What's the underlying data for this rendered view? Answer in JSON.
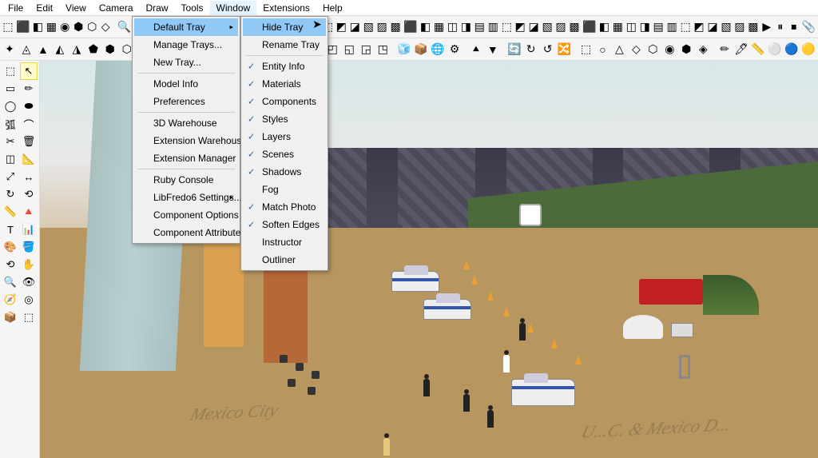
{
  "menubar": [
    "File",
    "Edit",
    "View",
    "Camera",
    "Draw",
    "Tools",
    "Window",
    "Extensions",
    "Help"
  ],
  "active_menu": "Window",
  "window_menu": {
    "groups": [
      [
        "Default Tray",
        "Manage Trays...",
        "New Tray..."
      ],
      [
        "Model Info",
        "Preferences"
      ],
      [
        "3D Warehouse",
        "Extension Warehouse",
        "Extension Manager"
      ],
      [
        "Ruby Console",
        "LibFredo6 Settings...",
        "Component Options",
        "Component Attributes"
      ]
    ],
    "highlighted": "Default Tray",
    "has_submenu": [
      "Default Tray",
      "LibFredo6 Settings..."
    ]
  },
  "tray_submenu": {
    "groups": [
      [
        "Hide Tray",
        "Rename Tray"
      ],
      [
        "Entity Info",
        "Materials",
        "Components",
        "Styles",
        "Layers",
        "Scenes",
        "Shadows",
        "Fog",
        "Match Photo",
        "Soften Edges",
        "Instructor",
        "Outliner"
      ]
    ],
    "highlighted": "Hide Tray",
    "checked": [
      "Entity Info",
      "Materials",
      "Components",
      "Styles",
      "Layers",
      "Scenes",
      "Shadows",
      "Match Photo",
      "Soften Edges"
    ]
  },
  "toolbar1_icons": [
    "⬚",
    "⬛",
    "◧",
    "▦",
    "◉",
    "⬢",
    "⬡",
    "◇",
    "",
    "🔍",
    "✋",
    "◎",
    ",⟲",
    "🏠",
    "",
    "📁",
    "🔧",
    "🗂",
    "📐",
    "",
    "◫",
    "◨",
    "▤",
    "▥",
    "⬚",
    "◩",
    "◪",
    "▧",
    "▨",
    "▩",
    "⬛",
    "◧",
    "▦",
    "◫",
    "◨",
    "▤",
    "▥",
    "⬚",
    "◩",
    "◪",
    "▧",
    "▨",
    "▩",
    "⬛",
    "◧",
    "▦",
    "◫",
    "◨",
    "▤",
    "▥",
    "⬚",
    "◩",
    "◪",
    "▧",
    "▨",
    "▩",
    "▶",
    "⏸",
    "⏹",
    "📎"
  ],
  "toolbar2_icons": [
    "✦",
    "◬",
    "▲",
    "◭",
    "◮",
    "⬟",
    "⬢",
    "⬡",
    "◈",
    "",
    "◐",
    "◑",
    "◒",
    "◓",
    "⬙",
    "⬘",
    "⊞",
    "⊟",
    "⊠",
    "⊡",
    "◰",
    "◱",
    "◲",
    "◳",
    "",
    "🧊",
    "📦",
    "🌐",
    "⚙",
    "",
    "⯅",
    "▼",
    "",
    "🔄",
    "↻",
    "↺",
    "🔀",
    "",
    "⬚",
    "○",
    "△",
    "◇",
    "⬡",
    "◉",
    "⬢",
    "◈",
    "",
    "✏",
    "🖊",
    "📏",
    "⚪",
    "🔵",
    "🟡"
  ],
  "left_tools": [
    [
      "⬚",
      "↖"
    ],
    [
      "▭",
      "✏"
    ],
    [
      "◯",
      "⬬"
    ],
    [
      "弧",
      "⌒"
    ],
    [
      "✂",
      "🗑"
    ],
    [
      "◫",
      "📐"
    ],
    [
      "⤢",
      "↔"
    ],
    [
      "↻",
      "⟲"
    ],
    [
      "📏",
      "🔺"
    ],
    [
      "T",
      "📊"
    ],
    [
      "🎨",
      "🪣"
    ],
    [
      "⟲",
      "✋"
    ],
    [
      "🔍",
      "👁"
    ],
    [
      "🧭",
      "◎"
    ],
    [
      "📦",
      "⬚"
    ]
  ],
  "scene_text_1": "Mexico City",
  "scene_text_2": "U...C.  &  Mexico  D..."
}
